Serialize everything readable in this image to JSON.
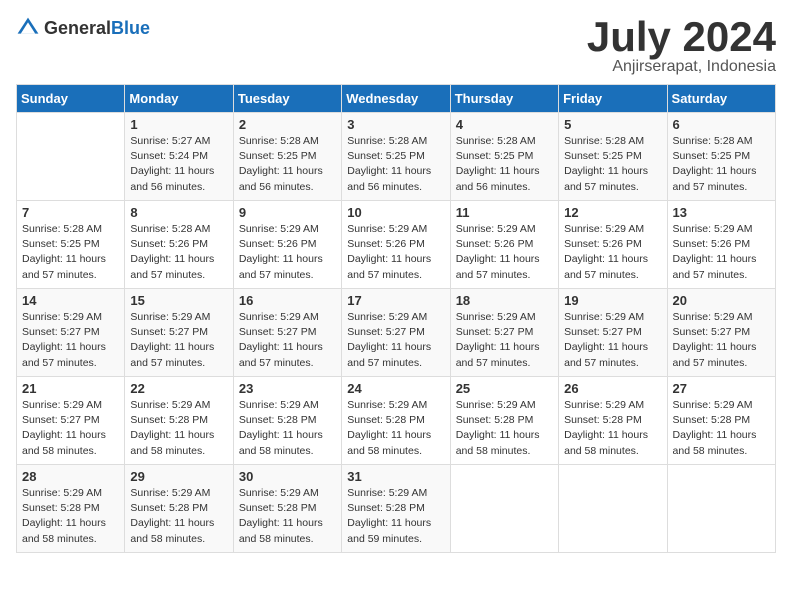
{
  "header": {
    "logo_general": "General",
    "logo_blue": "Blue",
    "month": "July 2024",
    "location": "Anjirserapat, Indonesia"
  },
  "days_of_week": [
    "Sunday",
    "Monday",
    "Tuesday",
    "Wednesday",
    "Thursday",
    "Friday",
    "Saturday"
  ],
  "weeks": [
    [
      {
        "num": "",
        "info": ""
      },
      {
        "num": "1",
        "info": "Sunrise: 5:27 AM\nSunset: 5:24 PM\nDaylight: 11 hours\nand 56 minutes."
      },
      {
        "num": "2",
        "info": "Sunrise: 5:28 AM\nSunset: 5:25 PM\nDaylight: 11 hours\nand 56 minutes."
      },
      {
        "num": "3",
        "info": "Sunrise: 5:28 AM\nSunset: 5:25 PM\nDaylight: 11 hours\nand 56 minutes."
      },
      {
        "num": "4",
        "info": "Sunrise: 5:28 AM\nSunset: 5:25 PM\nDaylight: 11 hours\nand 56 minutes."
      },
      {
        "num": "5",
        "info": "Sunrise: 5:28 AM\nSunset: 5:25 PM\nDaylight: 11 hours\nand 57 minutes."
      },
      {
        "num": "6",
        "info": "Sunrise: 5:28 AM\nSunset: 5:25 PM\nDaylight: 11 hours\nand 57 minutes."
      }
    ],
    [
      {
        "num": "7",
        "info": "Sunrise: 5:28 AM\nSunset: 5:25 PM\nDaylight: 11 hours\nand 57 minutes."
      },
      {
        "num": "8",
        "info": "Sunrise: 5:28 AM\nSunset: 5:26 PM\nDaylight: 11 hours\nand 57 minutes."
      },
      {
        "num": "9",
        "info": "Sunrise: 5:29 AM\nSunset: 5:26 PM\nDaylight: 11 hours\nand 57 minutes."
      },
      {
        "num": "10",
        "info": "Sunrise: 5:29 AM\nSunset: 5:26 PM\nDaylight: 11 hours\nand 57 minutes."
      },
      {
        "num": "11",
        "info": "Sunrise: 5:29 AM\nSunset: 5:26 PM\nDaylight: 11 hours\nand 57 minutes."
      },
      {
        "num": "12",
        "info": "Sunrise: 5:29 AM\nSunset: 5:26 PM\nDaylight: 11 hours\nand 57 minutes."
      },
      {
        "num": "13",
        "info": "Sunrise: 5:29 AM\nSunset: 5:26 PM\nDaylight: 11 hours\nand 57 minutes."
      }
    ],
    [
      {
        "num": "14",
        "info": "Sunrise: 5:29 AM\nSunset: 5:27 PM\nDaylight: 11 hours\nand 57 minutes."
      },
      {
        "num": "15",
        "info": "Sunrise: 5:29 AM\nSunset: 5:27 PM\nDaylight: 11 hours\nand 57 minutes."
      },
      {
        "num": "16",
        "info": "Sunrise: 5:29 AM\nSunset: 5:27 PM\nDaylight: 11 hours\nand 57 minutes."
      },
      {
        "num": "17",
        "info": "Sunrise: 5:29 AM\nSunset: 5:27 PM\nDaylight: 11 hours\nand 57 minutes."
      },
      {
        "num": "18",
        "info": "Sunrise: 5:29 AM\nSunset: 5:27 PM\nDaylight: 11 hours\nand 57 minutes."
      },
      {
        "num": "19",
        "info": "Sunrise: 5:29 AM\nSunset: 5:27 PM\nDaylight: 11 hours\nand 57 minutes."
      },
      {
        "num": "20",
        "info": "Sunrise: 5:29 AM\nSunset: 5:27 PM\nDaylight: 11 hours\nand 57 minutes."
      }
    ],
    [
      {
        "num": "21",
        "info": "Sunrise: 5:29 AM\nSunset: 5:27 PM\nDaylight: 11 hours\nand 58 minutes."
      },
      {
        "num": "22",
        "info": "Sunrise: 5:29 AM\nSunset: 5:28 PM\nDaylight: 11 hours\nand 58 minutes."
      },
      {
        "num": "23",
        "info": "Sunrise: 5:29 AM\nSunset: 5:28 PM\nDaylight: 11 hours\nand 58 minutes."
      },
      {
        "num": "24",
        "info": "Sunrise: 5:29 AM\nSunset: 5:28 PM\nDaylight: 11 hours\nand 58 minutes."
      },
      {
        "num": "25",
        "info": "Sunrise: 5:29 AM\nSunset: 5:28 PM\nDaylight: 11 hours\nand 58 minutes."
      },
      {
        "num": "26",
        "info": "Sunrise: 5:29 AM\nSunset: 5:28 PM\nDaylight: 11 hours\nand 58 minutes."
      },
      {
        "num": "27",
        "info": "Sunrise: 5:29 AM\nSunset: 5:28 PM\nDaylight: 11 hours\nand 58 minutes."
      }
    ],
    [
      {
        "num": "28",
        "info": "Sunrise: 5:29 AM\nSunset: 5:28 PM\nDaylight: 11 hours\nand 58 minutes."
      },
      {
        "num": "29",
        "info": "Sunrise: 5:29 AM\nSunset: 5:28 PM\nDaylight: 11 hours\nand 58 minutes."
      },
      {
        "num": "30",
        "info": "Sunrise: 5:29 AM\nSunset: 5:28 PM\nDaylight: 11 hours\nand 58 minutes."
      },
      {
        "num": "31",
        "info": "Sunrise: 5:29 AM\nSunset: 5:28 PM\nDaylight: 11 hours\nand 59 minutes."
      },
      {
        "num": "",
        "info": ""
      },
      {
        "num": "",
        "info": ""
      },
      {
        "num": "",
        "info": ""
      }
    ]
  ]
}
